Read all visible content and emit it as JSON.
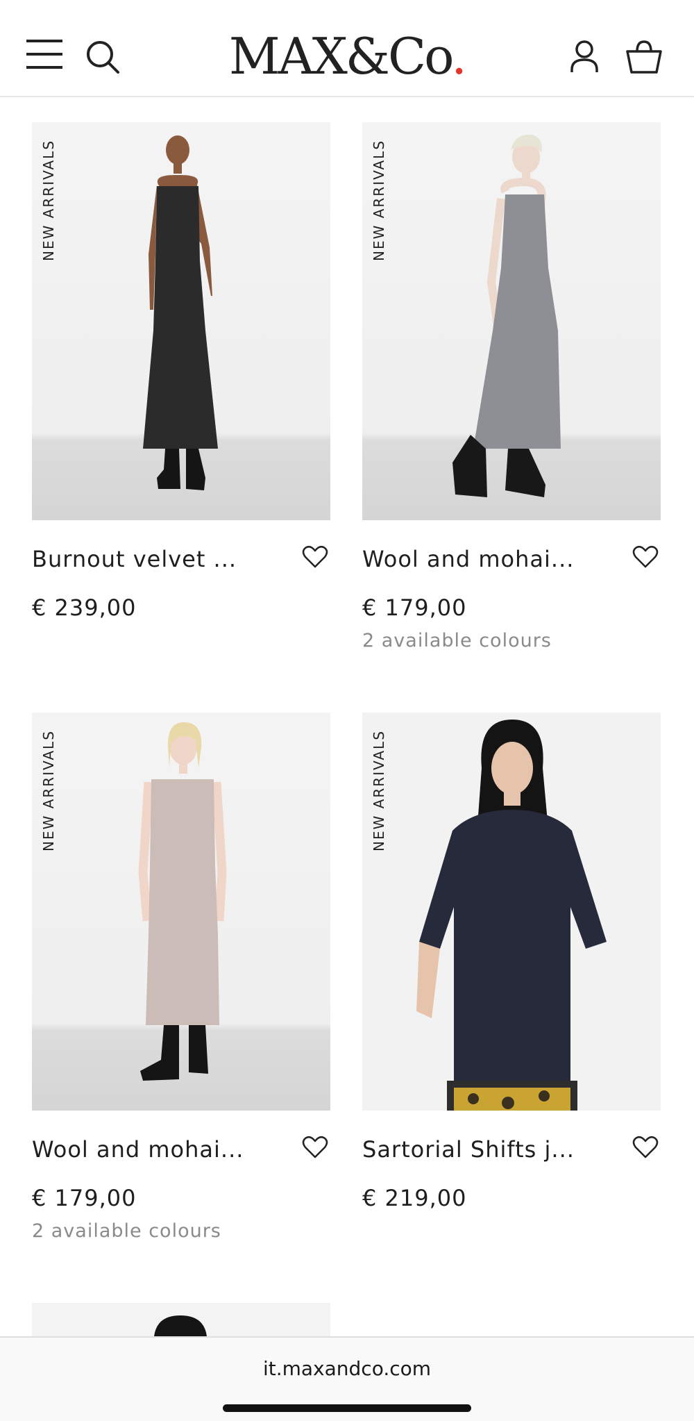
{
  "header": {
    "logo_text": "MAX&Co",
    "logo_dot": ".",
    "icons": [
      "menu-icon",
      "search-icon",
      "account-icon",
      "shopping-bag-icon"
    ],
    "accent_color": "#e0362c"
  },
  "products": [
    {
      "badge": "NEW ARRIVALS",
      "title": "Burnout velvet ...",
      "price": "€ 239,00",
      "colours": "",
      "dress_color": "#2b2b2b"
    },
    {
      "badge": "NEW ARRIVALS",
      "title": "Wool and mohai...",
      "price": "€ 179,00",
      "colours": "2 available colours",
      "dress_color": "#8d8f95"
    },
    {
      "badge": "NEW ARRIVALS",
      "title": "Wool and mohai...",
      "price": "€ 179,00",
      "colours": "2 available colours",
      "dress_color": "#cbbcb7"
    },
    {
      "badge": "NEW ARRIVALS",
      "title": "Sartorial Shifts j...",
      "price": "€ 219,00",
      "colours": "",
      "dress_color": "#262a3b"
    }
  ],
  "browser": {
    "url": "it.maxandco.com"
  }
}
